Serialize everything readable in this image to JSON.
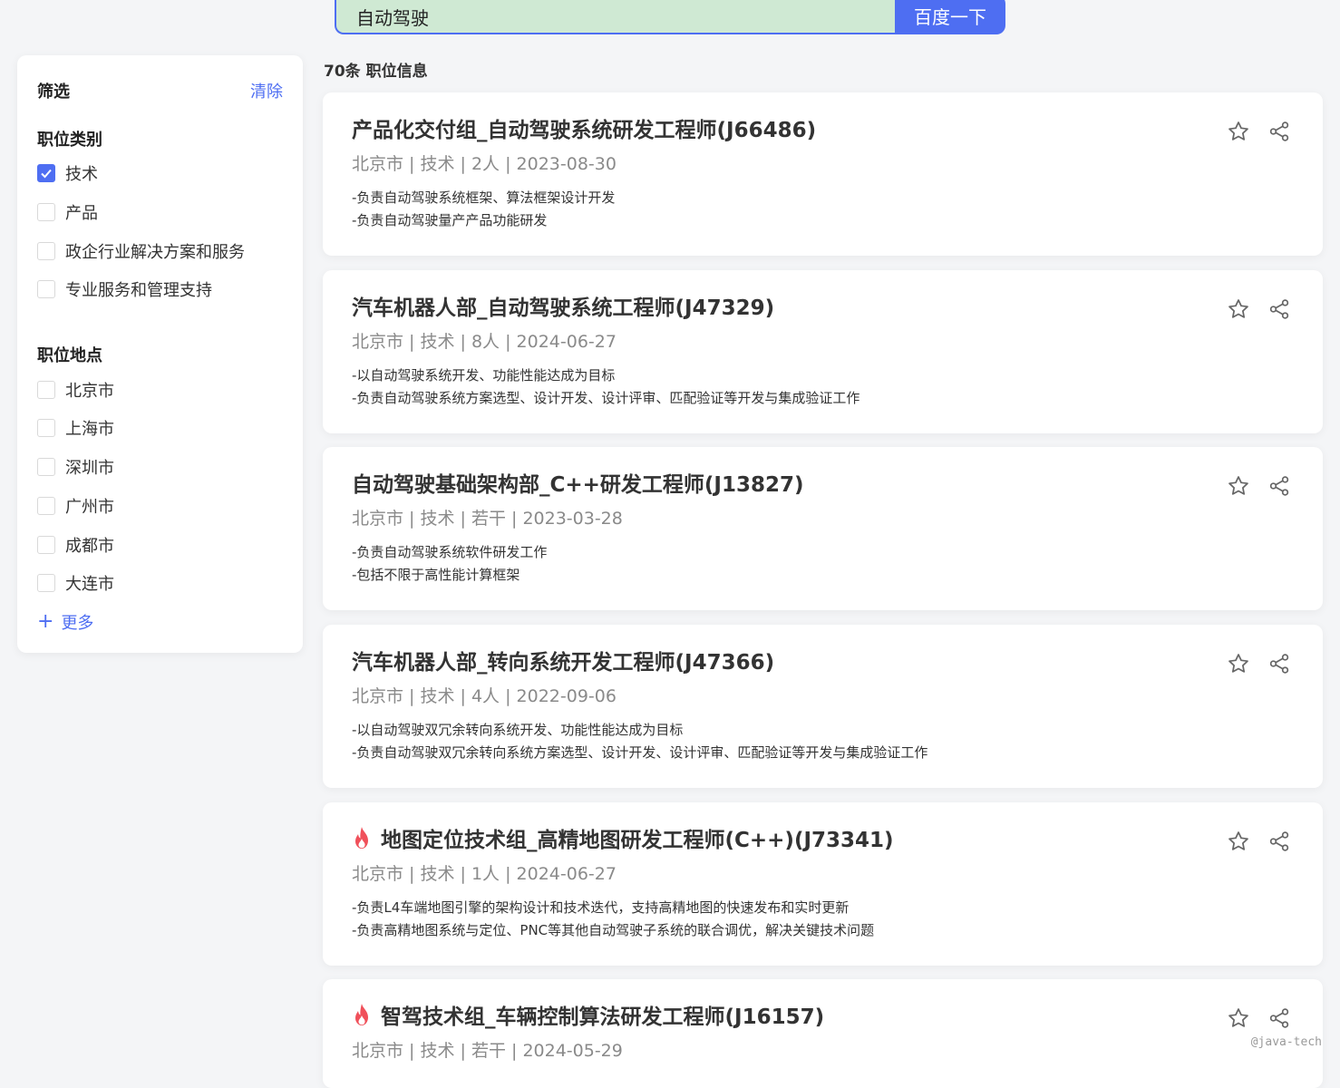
{
  "search": {
    "value": "自动驾驶",
    "button_label": "百度一下"
  },
  "sidebar": {
    "title": "筛选",
    "clear_label": "清除",
    "category": {
      "title": "职位类别",
      "options": [
        {
          "label": "技术",
          "checked": true
        },
        {
          "label": "产品",
          "checked": false
        },
        {
          "label": "政企行业解决方案和服务",
          "checked": false
        },
        {
          "label": "专业服务和管理支持",
          "checked": false
        }
      ]
    },
    "location": {
      "title": "职位地点",
      "options": [
        {
          "label": "北京市",
          "checked": false
        },
        {
          "label": "上海市",
          "checked": false
        },
        {
          "label": "深圳市",
          "checked": false
        },
        {
          "label": "广州市",
          "checked": false
        },
        {
          "label": "成都市",
          "checked": false
        },
        {
          "label": "大连市",
          "checked": false
        }
      ],
      "more_label": "更多"
    }
  },
  "results": {
    "count_label": "70条 职位信息",
    "jobs": [
      {
        "title": "产品化交付组_自动驾驶系统研发工程师(J66486)",
        "hot": false,
        "meta": "北京市 | 技术 | 2人 | 2023-08-30",
        "desc": [
          "-负责自动驾驶系统框架、算法框架设计开发",
          "-负责自动驾驶量产产品功能研发"
        ]
      },
      {
        "title": "汽车机器人部_自动驾驶系统工程师(J47329)",
        "hot": false,
        "meta": "北京市 | 技术 | 8人 | 2024-06-27",
        "desc": [
          "-以自动驾驶系统开发、功能性能达成为目标",
          "-负责自动驾驶系统方案选型、设计开发、设计评审、匹配验证等开发与集成验证工作"
        ]
      },
      {
        "title": "自动驾驶基础架构部_C++研发工程师(J13827)",
        "hot": false,
        "meta": "北京市 | 技术 | 若干 | 2023-03-28",
        "desc": [
          "-负责自动驾驶系统软件研发工作",
          "-包括不限于高性能计算框架"
        ]
      },
      {
        "title": "汽车机器人部_转向系统开发工程师(J47366)",
        "hot": false,
        "meta": "北京市 | 技术 | 4人 | 2022-09-06",
        "desc": [
          "-以自动驾驶双冗余转向系统开发、功能性能达成为目标",
          "-负责自动驾驶双冗余转向系统方案选型、设计开发、设计评审、匹配验证等开发与集成验证工作"
        ]
      },
      {
        "title": "地图定位技术组_高精地图研发工程师(C++)(J73341)",
        "hot": true,
        "meta": "北京市 | 技术 | 1人 | 2024-06-27",
        "desc": [
          "-负责L4车端地图引擎的架构设计和技术迭代，支持高精地图的快速发布和实时更新",
          "-负责高精地图系统与定位、PNC等其他自动驾驶子系统的联合调优，解决关键技术问题"
        ]
      },
      {
        "title": "智驾技术组_车辆控制算法研发工程师(J16157)",
        "hot": true,
        "meta": "北京市 | 技术 | 若干 | 2024-05-29",
        "desc": []
      }
    ]
  },
  "watermark": "@java-tech",
  "colors": {
    "accent": "#4e6ef2",
    "hot": "#f0505a",
    "search_bg": "#cfe9d3"
  },
  "icons": {
    "favorite": "star-icon",
    "share": "share-icon",
    "hot": "fire-icon",
    "add": "plus-icon",
    "check": "check-icon"
  }
}
